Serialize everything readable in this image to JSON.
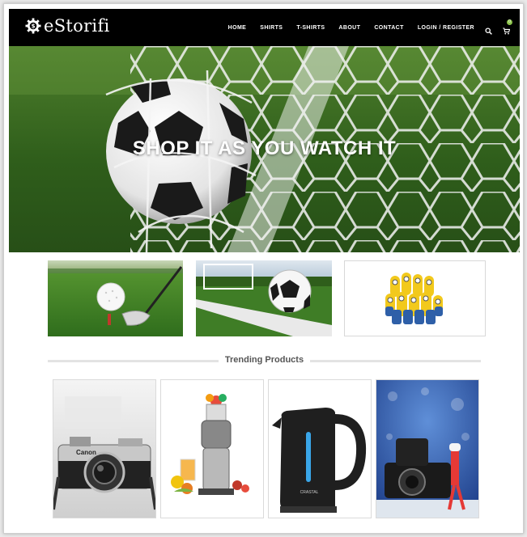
{
  "header": {
    "logo_text": "eStorifi",
    "nav": [
      {
        "label": "HOME"
      },
      {
        "label": "SHIRTS"
      },
      {
        "label": "T-SHIRTS"
      },
      {
        "label": "ABOUT"
      },
      {
        "label": "CONTACT"
      },
      {
        "label": "LOGIN / REGISTER"
      }
    ],
    "search_icon": "search-icon",
    "cart_icon": "cart-icon",
    "cart_count": "0"
  },
  "hero": {
    "title": "SHOP IT AS YOU WATCH IT"
  },
  "categories": [
    {
      "image": "golf-ball-on-tee"
    },
    {
      "image": "football-on-field"
    },
    {
      "image": "minions-group"
    }
  ],
  "trending": {
    "title": "Trending Products",
    "products": [
      {
        "image": "canon-camera",
        "brand_mark": "Canon"
      },
      {
        "image": "juicer"
      },
      {
        "image": "electric-kettle",
        "brand_mark": "CRASTAL"
      },
      {
        "image": "camera-with-toy"
      }
    ]
  },
  "colors": {
    "header_bg": "#000000",
    "accent_green": "#8bc34a",
    "section_line": "#e3e3e3",
    "title_text": "#555555"
  }
}
